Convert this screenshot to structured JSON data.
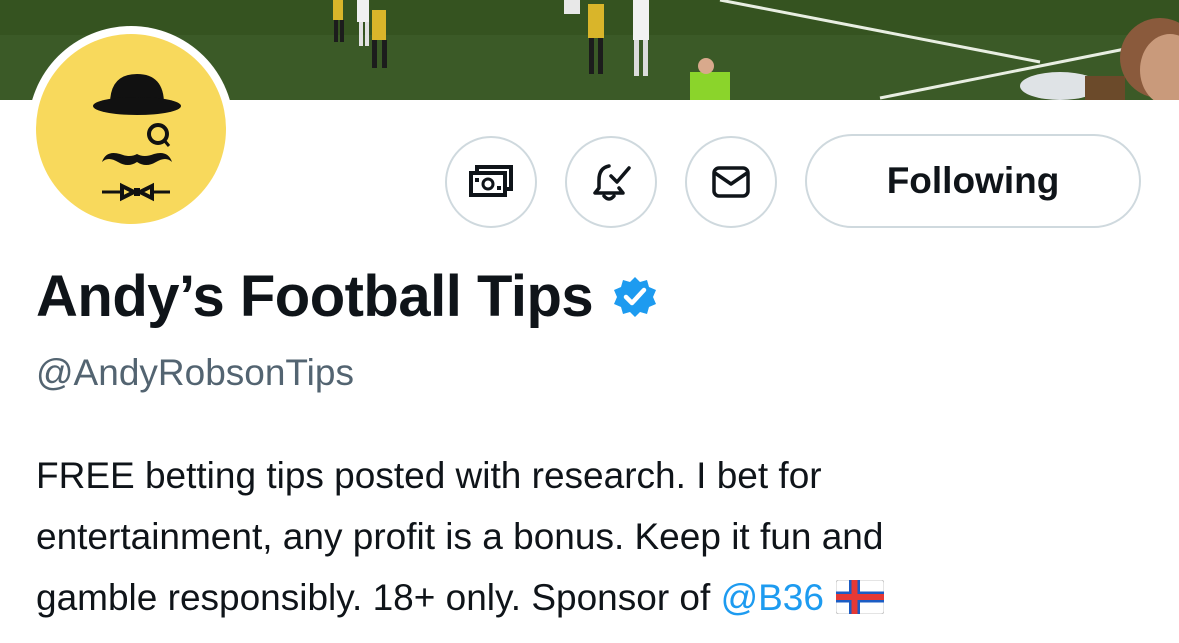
{
  "profile": {
    "display_name": "Andy’s Football Tips",
    "handle": "@AndyRobsonTips",
    "verified": true,
    "bio": {
      "line1": "FREE betting tips posted with research. I bet for",
      "line2": "entertainment, any profit is a bonus. Keep it fun and",
      "line3_prefix": "gamble responsibly. 18+ only. Sponsor of ",
      "mention": "@B36",
      "flag_icon": "faroe-islands-flag"
    }
  },
  "actions": {
    "tip_icon": "money-tip-icon",
    "notify_icon": "bell-check-icon",
    "message_icon": "envelope-icon",
    "following_label": "Following"
  },
  "colors": {
    "accent": "#1d9bf0",
    "avatar_bg": "#f8d95c",
    "border": "#cfd9de",
    "muted_text": "#536471",
    "text": "#0f1419"
  }
}
